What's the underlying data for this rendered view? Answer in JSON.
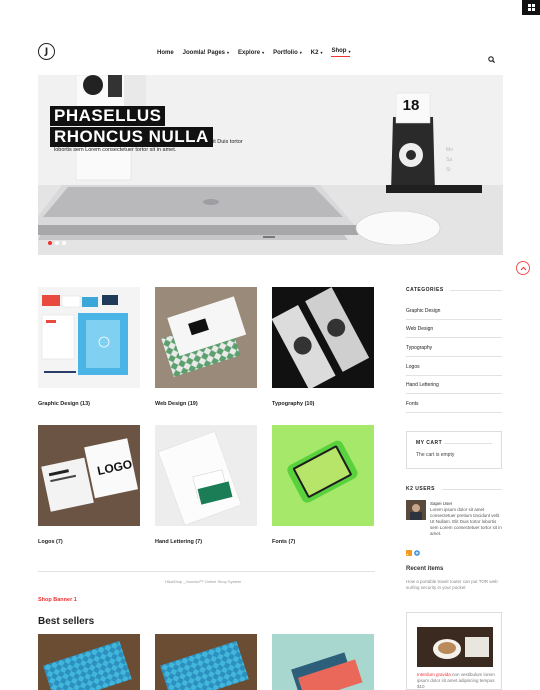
{
  "corner_menu": {
    "icon": "grid-menu-icon"
  },
  "header": {
    "logo": "J",
    "nav": [
      {
        "label": "Home",
        "caret": false
      },
      {
        "label": "Joomla! Pages",
        "caret": true
      },
      {
        "label": "Explore",
        "caret": true
      },
      {
        "label": "Portfolio",
        "caret": true
      },
      {
        "label": "K2",
        "caret": true
      },
      {
        "label": "Shop",
        "caret": true,
        "active": true
      }
    ],
    "caret_glyph": "▾",
    "search_icon": "search-icon"
  },
  "hero": {
    "title_line1": "PHASELLUS",
    "title_line2": "RHONCUS NULLA",
    "subtitle": "lobortis sem Lorem consectetuer tortor sit in amet.",
    "sub_tail": "it Duis tortor",
    "calendar_number": "18",
    "slides": 3,
    "active_slide": 1
  },
  "categories_grid": [
    {
      "label": "Graphic Design (13)"
    },
    {
      "label": "Web Design (19)"
    },
    {
      "label": "Typography (10)"
    },
    {
      "label": "Logos (7)"
    },
    {
      "label": "Hand Lettering (7)"
    },
    {
      "label": "Fonts (7)"
    }
  ],
  "footer_text": "HikaShop _Joomla!™ Online Shop System",
  "shop_banner": "Shop Banner 1",
  "best_sellers": "Best sellers",
  "sidebar": {
    "categories_title": "CATEGORIES",
    "categories": [
      "Graphic Design",
      "Web Design",
      "Typography",
      "Logos",
      "Hand Lettering",
      "Fonts"
    ],
    "cart_title": "MY CART",
    "cart_empty": "The cart is empty",
    "k2_users_title": "K2 USERS",
    "user_name": "Sapei User",
    "user_bio": "Lorem ipsum dolor sit amet consectetuer pretium tincidunt velit Ut Nullam. Elit Duis tortor lobortis sem Lorem consectetuer tortor sit in amet.",
    "recent_title": "Recent items",
    "recent_text": "How a portable travel router can put TOR web surfing security in your pocket",
    "item_title": "Interdum gravida",
    "item_text": " non vestibulum lorem ipsum dolor sit amet adipiscing tempus $10"
  },
  "colors": {
    "accent": "#e33333",
    "dark": "#111111",
    "green": "#a6e86a"
  }
}
